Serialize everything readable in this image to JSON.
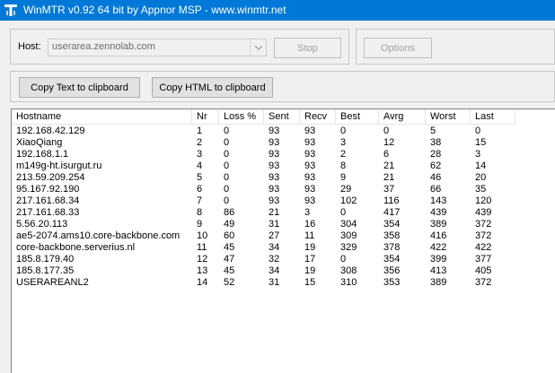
{
  "window": {
    "title": "WinMTR v0.92 64 bit by Appnor MSP - www.winmtr.net"
  },
  "host": {
    "label": "Host:",
    "value": "userarea.zennolab.com"
  },
  "buttons": {
    "stop": "Stop",
    "options": "Options",
    "copy_text": "Copy Text to clipboard",
    "copy_html": "Copy HTML to clipboard"
  },
  "table": {
    "headers": [
      "Hostname",
      "Nr",
      "Loss %",
      "Sent",
      "Recv",
      "Best",
      "Avrg",
      "Worst",
      "Last"
    ],
    "rows": [
      [
        "192.168.42.129",
        "1",
        "0",
        "93",
        "93",
        "0",
        "0",
        "5",
        "0"
      ],
      [
        "XiaoQiang",
        "2",
        "0",
        "93",
        "93",
        "3",
        "12",
        "38",
        "15"
      ],
      [
        "192.168.1.1",
        "3",
        "0",
        "93",
        "93",
        "2",
        "6",
        "28",
        "3"
      ],
      [
        "m149g-ht.isurgut.ru",
        "4",
        "0",
        "93",
        "93",
        "8",
        "21",
        "62",
        "14"
      ],
      [
        "213.59.209.254",
        "5",
        "0",
        "93",
        "93",
        "9",
        "21",
        "46",
        "20"
      ],
      [
        "95.167.92.190",
        "6",
        "0",
        "93",
        "93",
        "29",
        "37",
        "66",
        "35"
      ],
      [
        "217.161.68.34",
        "7",
        "0",
        "93",
        "93",
        "102",
        "116",
        "143",
        "120"
      ],
      [
        "217.161.68.33",
        "8",
        "86",
        "21",
        "3",
        "0",
        "417",
        "439",
        "439"
      ],
      [
        "5.56.20.113",
        "9",
        "49",
        "31",
        "16",
        "304",
        "354",
        "389",
        "372"
      ],
      [
        "ae5-2074.ams10.core-backbone.com",
        "10",
        "60",
        "27",
        "11",
        "309",
        "358",
        "416",
        "372"
      ],
      [
        "core-backbone.serverius.nl",
        "11",
        "45",
        "34",
        "19",
        "329",
        "378",
        "422",
        "422"
      ],
      [
        "185.8.179.40",
        "12",
        "47",
        "32",
        "17",
        "0",
        "354",
        "399",
        "377"
      ],
      [
        "185.8.177.35",
        "13",
        "45",
        "34",
        "19",
        "308",
        "356",
        "413",
        "405"
      ],
      [
        "USERAREANL2",
        "14",
        "52",
        "31",
        "15",
        "310",
        "353",
        "389",
        "372"
      ]
    ]
  }
}
